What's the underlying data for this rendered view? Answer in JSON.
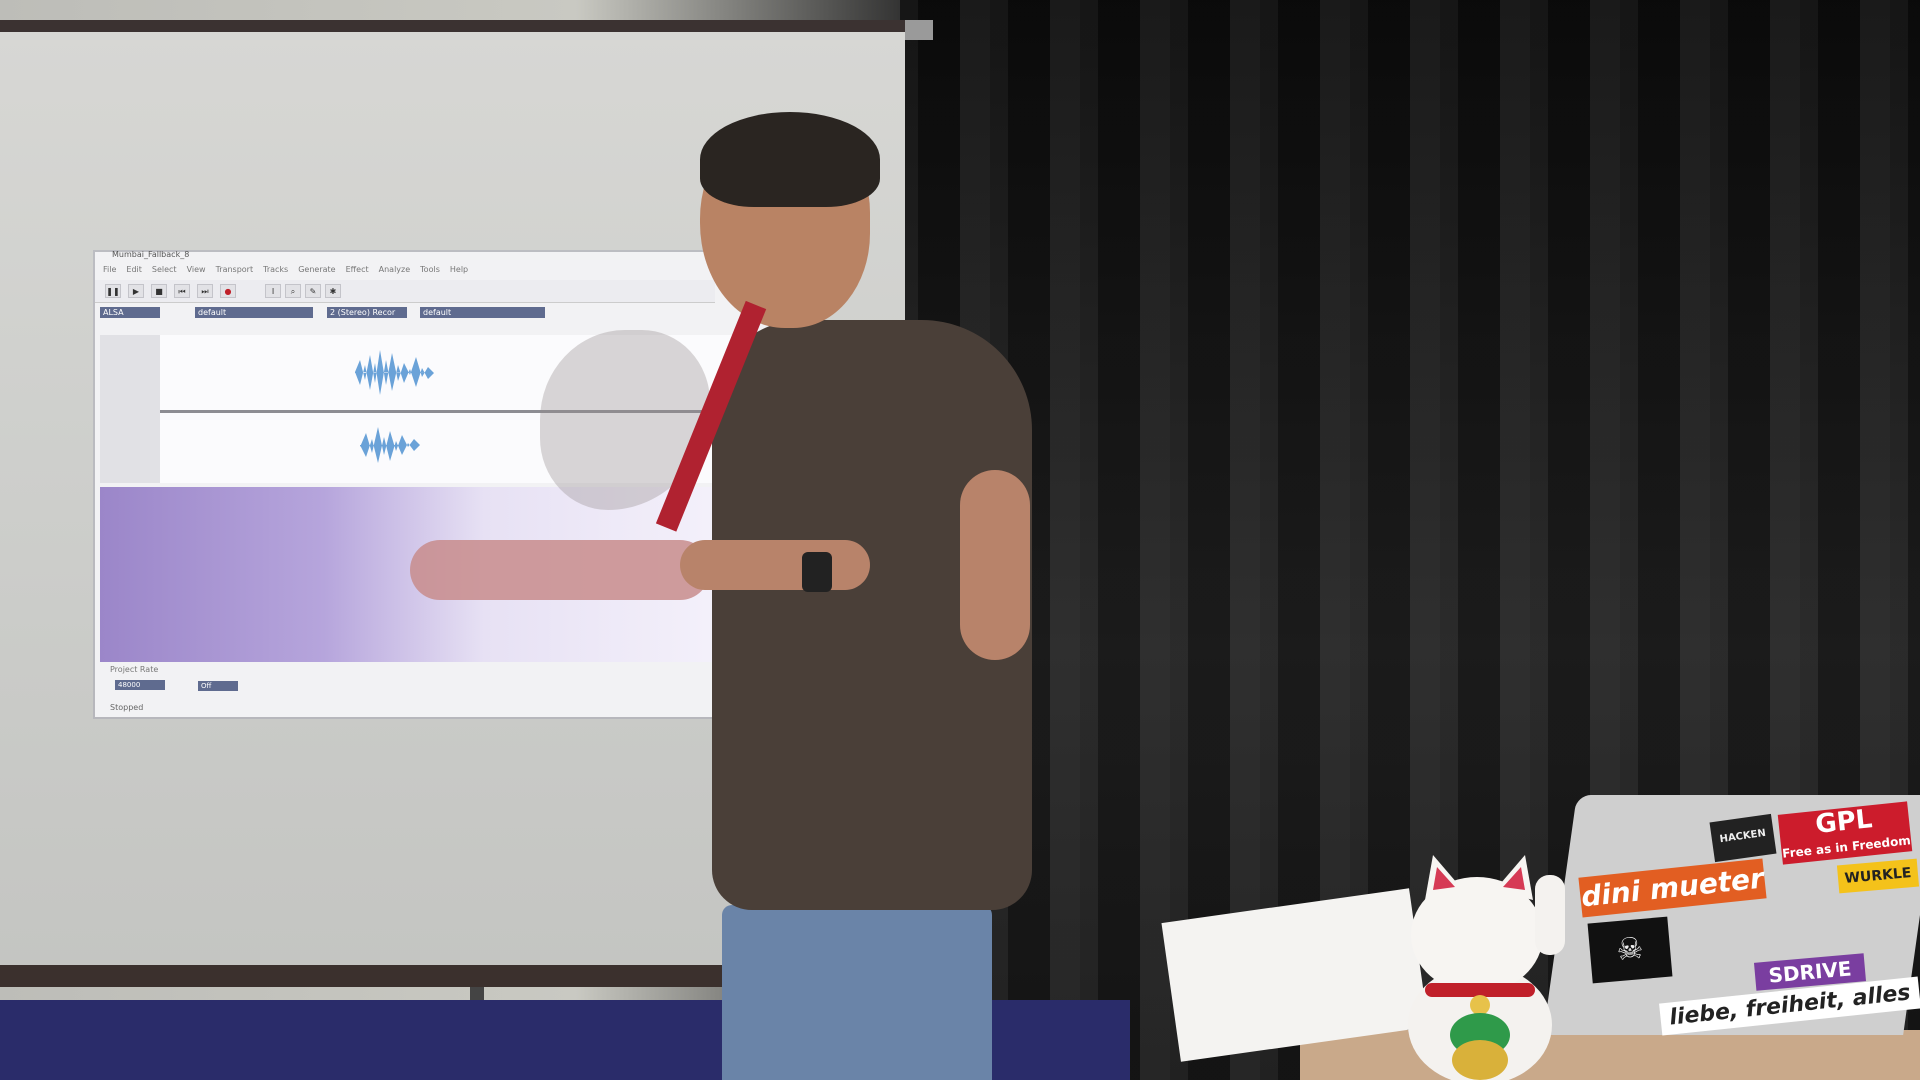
{
  "projection": {
    "window_title": "Mumbai_Fallback_8",
    "menu": [
      "File",
      "Edit",
      "Select",
      "View",
      "Transport",
      "Tracks",
      "Generate",
      "Effect",
      "Analyze",
      "Tools",
      "Help"
    ],
    "device_bar": {
      "host": "ALSA",
      "recording_device": "default",
      "channels": "2 (Stereo) Recor",
      "playback_device": "default"
    },
    "project_rate_label": "Project Rate",
    "project_rate_value": "48000",
    "snap_to_value": "Off",
    "status": "Stopped"
  },
  "stickers": {
    "dini": "dini mueter",
    "gpl": "GPL",
    "free": "Free as in Freedom",
    "hacken": "HACKEN",
    "liebe": "liebe, freiheit, alles",
    "sdrive": "SDRIVE",
    "wurkle": "WURKLE",
    "skull": "☠"
  },
  "colors": {
    "lanyard": "#b02230",
    "sticker_orange": "#e25e22",
    "sticker_red": "#cc1c2c",
    "waveform": "#6aa2d8"
  }
}
